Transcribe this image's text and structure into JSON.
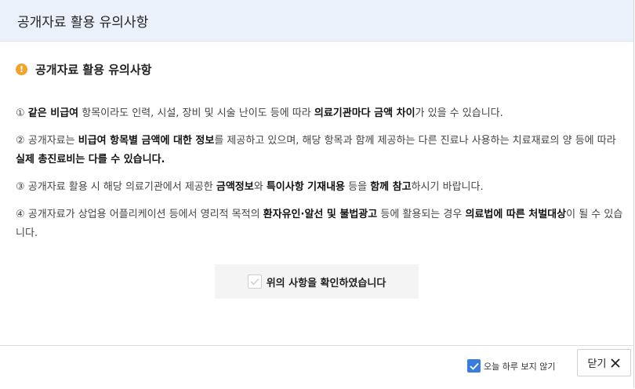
{
  "header": {
    "title": "공개자료 활용 유의사항"
  },
  "section": {
    "title": "공개자료 활용 유의사항",
    "icon": "warning-circle-icon",
    "icon_glyph": "!"
  },
  "notes": [
    {
      "parts": [
        {
          "t": "① "
        },
        {
          "t": "같은 비급여",
          "b": true
        },
        {
          "t": " 항목이라도 인력, 시설, 장비 및 시술 난이도 등에 따라 "
        },
        {
          "t": "의료기관마다 금액 차이",
          "b": true
        },
        {
          "t": "가 있을 수 있습니다."
        }
      ]
    },
    {
      "parts": [
        {
          "t": "② 공개자료는 "
        },
        {
          "t": "비급여 항목별 금액에 대한 정보",
          "b": true
        },
        {
          "t": "를 제공하고 있으며, 해당 항목과 함께 제공하는 다른 진료나 사용하는 치료재료의 양 등에 따라 "
        },
        {
          "t": "실제 총진료비는 다를 수 있습니다.",
          "b": true
        }
      ]
    },
    {
      "parts": [
        {
          "t": "③ 공개자료 활용 시 해당 의료기관에서 제공한 "
        },
        {
          "t": "금액정보",
          "b": true
        },
        {
          "t": "와 "
        },
        {
          "t": "특이사항 기재내용",
          "b": true
        },
        {
          "t": " 등을 "
        },
        {
          "t": "함께 참고",
          "b": true
        },
        {
          "t": "하시기 바랍니다."
        }
      ]
    },
    {
      "parts": [
        {
          "t": "④ 공개자료가 상업용 어플리케이션 등에서 영리적 목적의 "
        },
        {
          "t": "환자유인·알선 및 불법광고",
          "b": true
        },
        {
          "t": " 등에 활용되는 경우 "
        },
        {
          "t": "의료법에 따른 처벌대상",
          "b": true
        },
        {
          "t": "이 될 수 있습니다."
        }
      ]
    }
  ],
  "confirm": {
    "label": "위의 사항을 확인하였습니다",
    "checked": false
  },
  "footer": {
    "today_label": "오늘 하루 보지 않기",
    "today_checked": true,
    "close_label": "닫기",
    "close_icon": "close-icon"
  },
  "colors": {
    "header_bg": "#eaf1fb",
    "warning": "#f2a32b",
    "checkbox": "#3b7ddd"
  }
}
